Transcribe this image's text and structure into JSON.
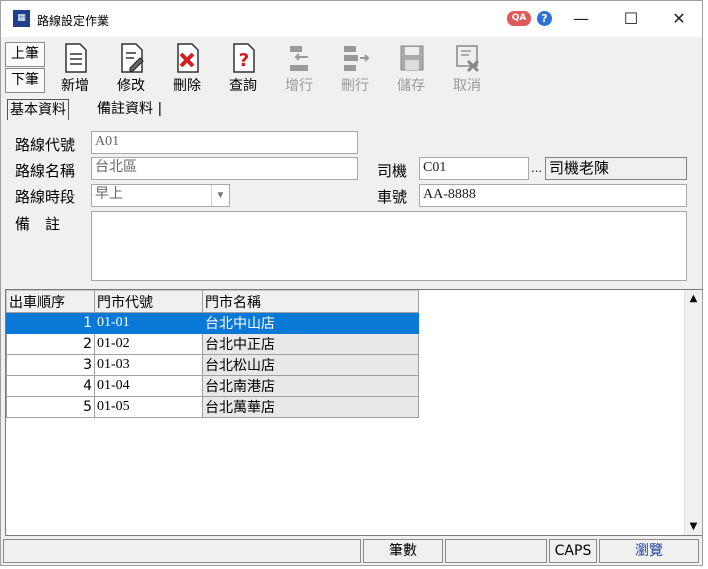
{
  "window": {
    "title": "路線設定作業",
    "qa_badge": "QA",
    "help_icon": "help-icon",
    "minimize": "—",
    "maximize": "☐",
    "close": "✕"
  },
  "toolbar": {
    "prev_label": "上筆",
    "next_label": "下筆",
    "buttons": [
      {
        "label": "新增",
        "icon": "new-document-icon",
        "enabled": true
      },
      {
        "label": "修改",
        "icon": "edit-document-icon",
        "enabled": true
      },
      {
        "label": "刪除",
        "icon": "delete-icon",
        "enabled": true
      },
      {
        "label": "查詢",
        "icon": "query-icon",
        "enabled": true
      },
      {
        "label": "增行",
        "icon": "insert-row-icon",
        "enabled": false
      },
      {
        "label": "刪行",
        "icon": "delete-row-icon",
        "enabled": false
      },
      {
        "label": "儲存",
        "icon": "save-icon",
        "enabled": false
      },
      {
        "label": "取消",
        "icon": "cancel-icon",
        "enabled": false
      }
    ]
  },
  "tabs": {
    "basic": "基本資料",
    "notes": "備註資料"
  },
  "form": {
    "route_code_label": "路線代號",
    "route_code": "A01",
    "route_name_label": "路線名稱",
    "route_name": "台北區",
    "route_period_label": "路線時段",
    "route_period": "早上",
    "remark_label": "備　註",
    "remark": "",
    "driver_label": "司機",
    "driver_code": "C01",
    "driver_name": "司機老陳",
    "plate_label": "車號",
    "plate": "AA-8888"
  },
  "grid": {
    "columns": [
      "出車順序",
      "門市代號",
      "門市名稱"
    ],
    "rows": [
      {
        "seq": "1",
        "code": "01-01",
        "name": "台北中山店",
        "selected": true
      },
      {
        "seq": "2",
        "code": "01-02",
        "name": "台北中正店",
        "selected": false
      },
      {
        "seq": "3",
        "code": "01-03",
        "name": "台北松山店",
        "selected": false
      },
      {
        "seq": "4",
        "code": "01-04",
        "name": "台北南港店",
        "selected": false
      },
      {
        "seq": "5",
        "code": "01-05",
        "name": "台北萬華店",
        "selected": false
      }
    ]
  },
  "status": {
    "count_label": "筆數",
    "count_value": "",
    "caps": "CAPS",
    "mode": "瀏覽"
  },
  "colors": {
    "selection": "#0a78d7",
    "mode_text": "#1a3fa0"
  }
}
